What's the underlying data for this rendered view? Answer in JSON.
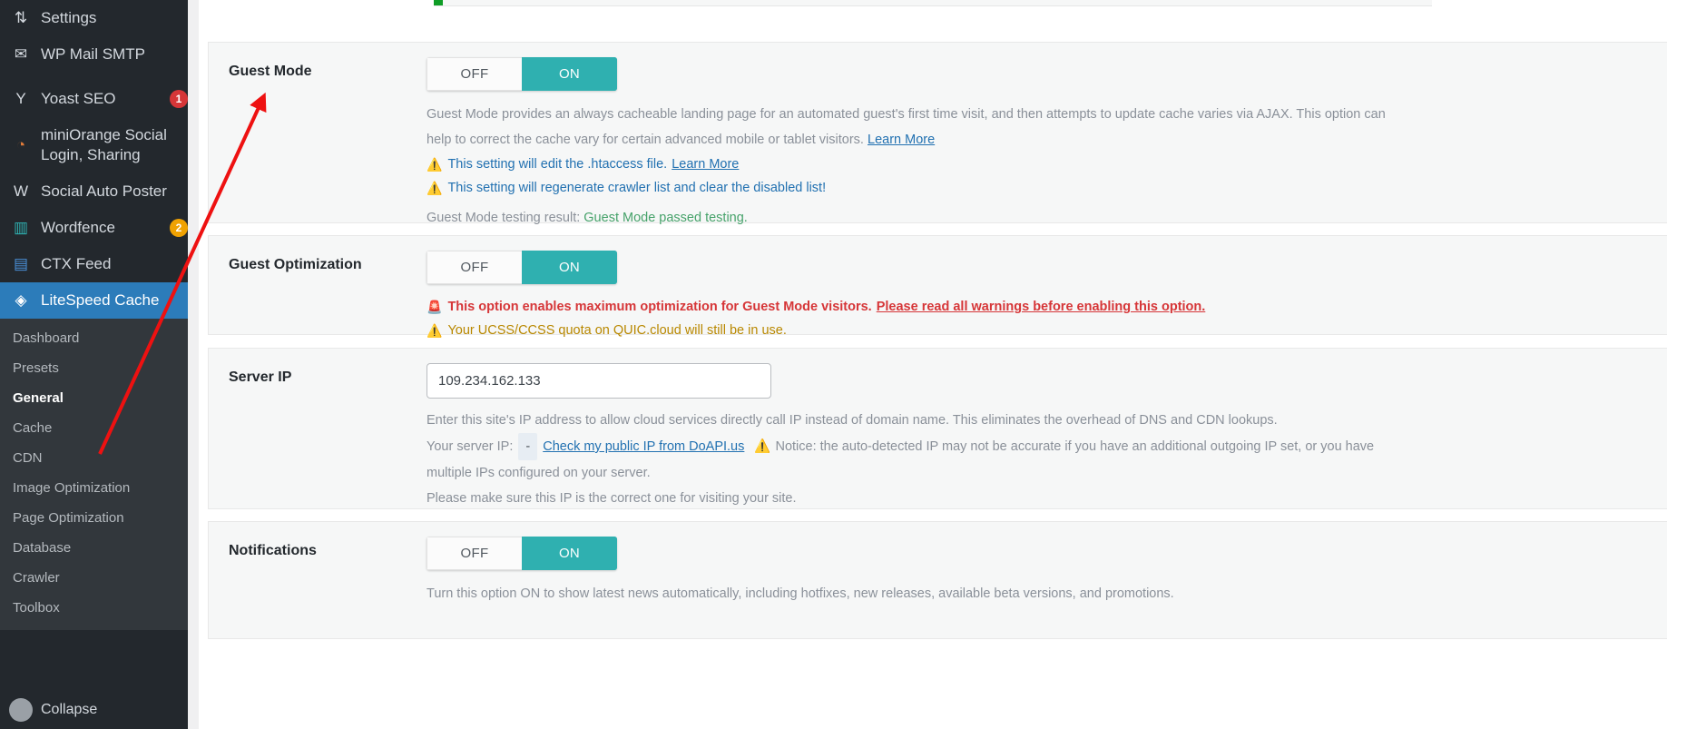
{
  "sidebar": {
    "top_items": [
      {
        "label": "Settings",
        "icon": "settings-sliders-icon",
        "glyph": "⇅",
        "badge": null
      },
      {
        "label": "WP Mail SMTP",
        "icon": "mail-icon",
        "glyph": "✉",
        "badge": null
      },
      {
        "label": "Yoast SEO",
        "icon": "yoast-icon",
        "glyph": "Y",
        "badge": "1",
        "badge_color": "red"
      },
      {
        "label": "miniOrange Social Login, Sharing",
        "icon": "miniorange-icon",
        "glyph": "◔",
        "badge": null
      },
      {
        "label": "Social Auto Poster",
        "icon": "social-auto-poster-icon",
        "glyph": "W",
        "badge": null
      },
      {
        "label": "Wordfence",
        "icon": "wordfence-icon",
        "glyph": "▥",
        "badge": "2",
        "badge_color": "orange"
      },
      {
        "label": "CTX Feed",
        "icon": "ctx-feed-icon",
        "glyph": "▤",
        "badge": null
      },
      {
        "label": "LiteSpeed Cache",
        "icon": "litespeed-icon",
        "glyph": "◈",
        "badge": null,
        "current": true
      }
    ],
    "submenu": [
      {
        "label": "Dashboard",
        "active": false
      },
      {
        "label": "Presets",
        "active": false
      },
      {
        "label": "General",
        "active": true
      },
      {
        "label": "Cache",
        "active": false
      },
      {
        "label": "CDN",
        "active": false
      },
      {
        "label": "Image Optimization",
        "active": false
      },
      {
        "label": "Page Optimization",
        "active": false
      },
      {
        "label": "Database",
        "active": false
      },
      {
        "label": "Crawler",
        "active": false
      },
      {
        "label": "Toolbox",
        "active": false
      }
    ],
    "bottom_user": {
      "label": "Collapse",
      "icon": "avatar-icon"
    }
  },
  "settings": {
    "guest_mode": {
      "title": "Guest Mode",
      "toggle": {
        "off_label": "OFF",
        "on_label": "ON",
        "value": "ON"
      },
      "description_part1": "Guest Mode provides an always cacheable landing page for an automated guest's first time visit, and then attempts to update cache varies via AJAX. This option can help to correct the cache vary for certain advanced mobile or tablet visitors.",
      "description_link": "Learn More",
      "notes": [
        {
          "icon": "warning-triangle-icon",
          "glyph": "⚠",
          "text": "This setting will edit the .htaccess file.",
          "link": "Learn More",
          "style": "info"
        },
        {
          "icon": "warning-triangle-icon",
          "glyph": "⚠",
          "text": "This setting will regenerate crawler list and clear the disabled list!",
          "link": "",
          "style": "info"
        }
      ],
      "test_label": "Guest Mode testing result:",
      "test_value": "Guest Mode passed testing."
    },
    "guest_optimization": {
      "title": "Guest Optimization",
      "toggle": {
        "off_label": "OFF",
        "on_label": "ON",
        "value": "ON"
      },
      "notes": [
        {
          "icon": "siren-alarm-icon",
          "glyph": "🚨",
          "text": "This option enables maximum optimization for Guest Mode visitors.",
          "link": "Please read all warnings before enabling this option.",
          "style": "danger"
        },
        {
          "icon": "warning-triangle-icon",
          "glyph": "⚠",
          "text": "Your UCSS/CCSS quota on QUIC.cloud will still be in use.",
          "link": "",
          "style": "yellow"
        }
      ]
    },
    "server_ip": {
      "title": "Server IP",
      "input_value": "109.234.162.133",
      "input_placeholder": "",
      "description": "Enter this site's IP address to allow cloud services directly call IP instead of domain name. This eliminates the overhead of DNS and CDN lookups.",
      "your_server_ip_label": "Your server IP:",
      "your_server_ip_value": "-",
      "check_ip_link": "Check my public IP from DoAPI.us",
      "notice_icon": "warning-triangle-icon",
      "notice_text": "Notice: the auto-detected IP may not be accurate if you have an additional outgoing IP set, or you have multiple IPs configured on your server.",
      "please_make_sure": "Please make sure this IP is the correct one for visiting your site."
    },
    "notifications": {
      "title": "Notifications",
      "toggle": {
        "off_label": "OFF",
        "on_label": "ON",
        "value": "ON"
      },
      "description": "Turn this option ON to show latest news automatically, including hotfixes, new releases, available beta versions, and promotions."
    }
  },
  "colors": {
    "accent_teal": "#2FB0B0",
    "sidebar_bg": "#23282d",
    "submenu_bg": "#32373c",
    "current_menu_blue": "#2c7cba",
    "link_blue": "#2271b1",
    "danger_red": "#d63638",
    "pass_green": "#46a26a",
    "annotation_red": "#ee1111"
  },
  "annotation": {
    "type": "arrow",
    "color": "#ee1111",
    "points_from": "general-submenu-item",
    "points_to": "guest-mode-title"
  }
}
